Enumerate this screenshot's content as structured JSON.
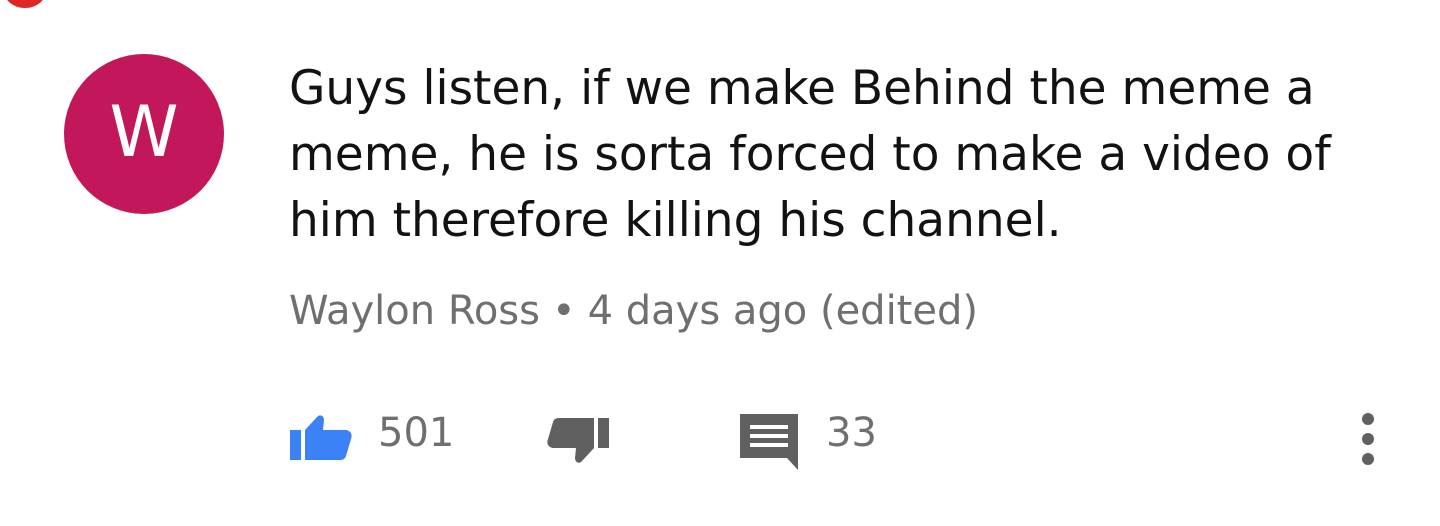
{
  "avatar": {
    "letter": "W",
    "color": "#c2185b"
  },
  "comment": {
    "text": "Guys listen, if we make Behind the meme a meme, he is sorta forced to make a video of him therefore killing his channel."
  },
  "meta": {
    "author": "Waylon Ross",
    "separator": "•",
    "time": "4 days ago (edited)"
  },
  "actions": {
    "like_count": "501",
    "reply_count": "33",
    "like_icon": "thumbs-up-icon",
    "dislike_icon": "thumbs-down-icon",
    "reply_icon": "comment-icon",
    "more_icon": "more-vert-icon",
    "like_color": "#3b82f6",
    "icon_color": "#606060"
  }
}
